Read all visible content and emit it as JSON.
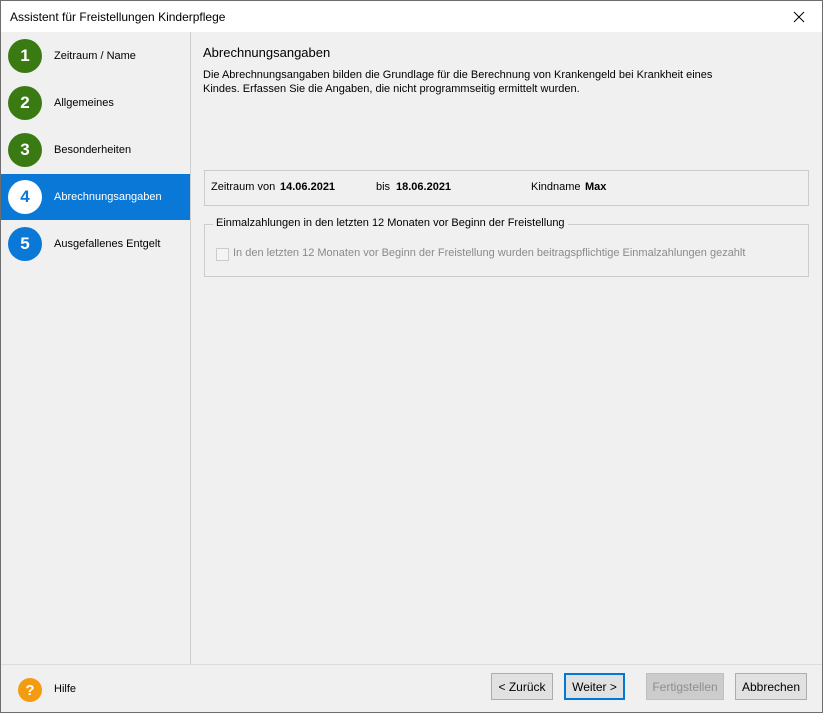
{
  "window": {
    "title": "Assistent für Freistellungen Kinderpflege"
  },
  "steps": [
    {
      "number": "1",
      "label": "Zeitraum / Name",
      "state": "done"
    },
    {
      "number": "2",
      "label": "Allgemeines",
      "state": "done"
    },
    {
      "number": "3",
      "label": "Besonderheiten",
      "state": "done"
    },
    {
      "number": "4",
      "label": "Abrechnungsangaben",
      "state": "current"
    },
    {
      "number": "5",
      "label": "Ausgefallenes Entgelt",
      "state": "todo"
    }
  ],
  "main": {
    "title": "Abrechnungsangaben",
    "description_line1": "Die Abrechnungsangaben bilden die Grundlage für die Berechnung von Krankengeld bei Krankheit eines",
    "description_line2": "Kindes. Erfassen Sie die Angaben, die nicht programmseitig ermittelt wurden.",
    "info": {
      "period_label": "Zeitraum von",
      "period_from": "14.06.2021",
      "to_label": "bis",
      "period_to": "18.06.2021",
      "child_label": "Kindname",
      "child_name": "Max"
    },
    "group": {
      "legend": "Einmalzahlungen in den letzten 12 Monaten vor Beginn der Freistellung",
      "checkbox_label": "In den letzten 12 Monaten vor Beginn der Freistellung wurden beitragspflichtige Einmalzahlungen gezahlt",
      "checked": false,
      "enabled": false
    }
  },
  "footer": {
    "help_icon": "?",
    "help_label": "Hilfe",
    "back_label": "< Zurück",
    "next_label": "Weiter >",
    "finish_label": "Fertigstellen",
    "cancel_label": "Abbrechen"
  },
  "colors": {
    "active_blue": "#0a78d7",
    "done_green": "#3a7a13",
    "help_orange": "#f39c12"
  }
}
